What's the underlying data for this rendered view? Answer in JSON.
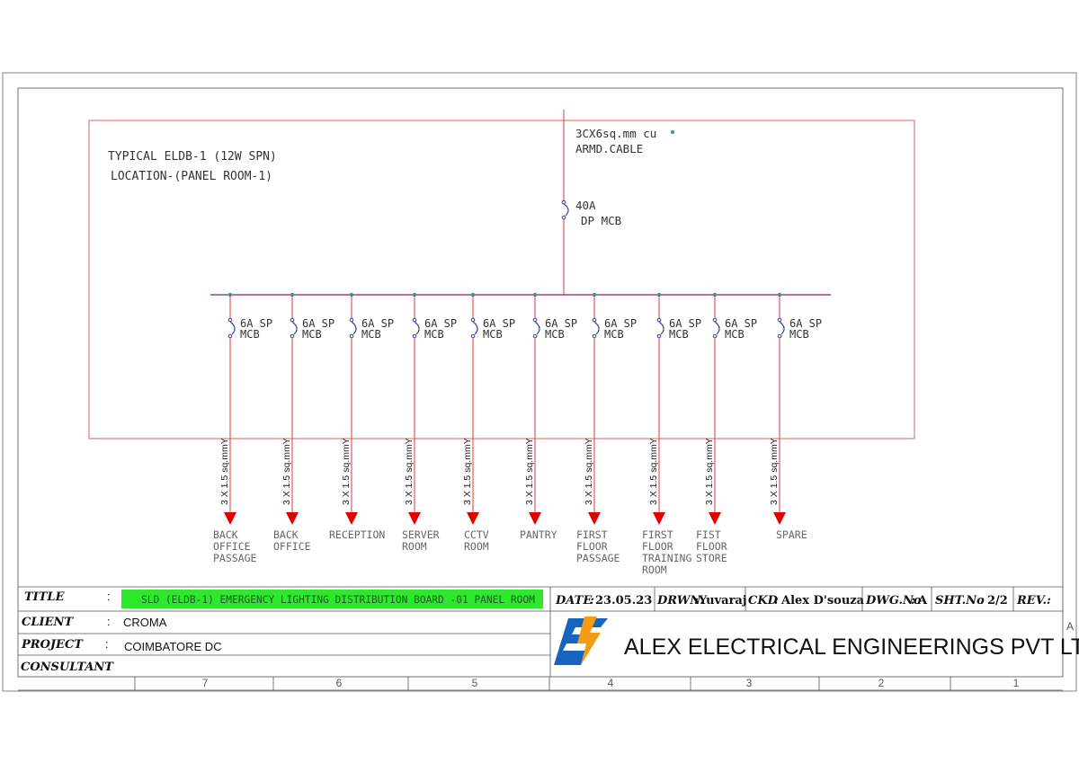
{
  "panel": {
    "title_line1": "TYPICAL ELDB-1 (12W SPN)",
    "title_line2": "LOCATION-(PANEL ROOM-1)",
    "incoming_cable_line1": "3CX6sq.mm cu",
    "incoming_cable_line2": "ARMD.CABLE",
    "main_breaker_line1": "40A",
    "main_breaker_line2": "DP MCB"
  },
  "feeders": [
    {
      "breaker": "6A SP",
      "breaker_type": "MCB",
      "cable": "3 X 1.5 sq.mmY",
      "load": [
        "BACK",
        "OFFICE",
        "PASSAGE"
      ]
    },
    {
      "breaker": "6A SP",
      "breaker_type": "MCB",
      "cable": "3 X 1.5 sq.mmY",
      "load": [
        "BACK",
        "OFFICE"
      ]
    },
    {
      "breaker": "6A SP",
      "breaker_type": "MCB",
      "cable": "3 X 1.5 sq.mmY",
      "load": [
        "RECEPTION"
      ]
    },
    {
      "breaker": "6A SP",
      "breaker_type": "MCB",
      "cable": "3 X 1.5 sq.mmY",
      "load": [
        "SERVER",
        "ROOM"
      ]
    },
    {
      "breaker": "6A SP",
      "breaker_type": "MCB",
      "cable": "3 X 1.5 sq.mmY",
      "load": [
        "CCTV",
        "ROOM"
      ]
    },
    {
      "breaker": "6A SP",
      "breaker_type": "MCB",
      "cable": "3 X 1.5 sq.mmY",
      "load": [
        "PANTRY"
      ]
    },
    {
      "breaker": "6A SP",
      "breaker_type": "MCB",
      "cable": "3 X 1.5 sq.mmY",
      "load": [
        "FIRST",
        "FLOOR",
        "PASSAGE"
      ]
    },
    {
      "breaker": "6A SP",
      "breaker_type": "MCB",
      "cable": "3 X 1.5 sq.mmY",
      "load": [
        "FIRST",
        "FLOOR",
        "TRAINING",
        "ROOM"
      ]
    },
    {
      "breaker": "6A SP",
      "breaker_type": "MCB",
      "cable": "3 X 1.5 sq.mmY",
      "load": [
        "FIST",
        "FLOOR",
        "STORE"
      ]
    },
    {
      "breaker": "6A SP",
      "breaker_type": "MCB",
      "cable": "3 X 1.5 sq.mmY",
      "load": [
        "SPARE"
      ]
    }
  ],
  "title_block": {
    "title_label": "TITLE",
    "title_value": "SLD (ELDB-1) EMERGENCY LIGHTING DISTRIBUTION BOARD -01 PANEL ROOM",
    "client_label": "CLIENT",
    "client_value": "CROMA",
    "project_label": "PROJECT",
    "project_value": "COIMBATORE DC",
    "consultant_label": "CONSULTANT",
    "colon": ":",
    "date_label": "DATE",
    "date_value": "23.05.23",
    "drawn_label": "DRWN.",
    "drawn_value": "Yuvaraj",
    "checked_label": "CKD",
    "checked_value": "Alex D'souza",
    "dwg_label": "DWG.No",
    "dwg_value": "A",
    "sht_label": "SHT.No",
    "sht_value": "2/2",
    "rev_label": "REV.",
    "company_name": "ALEX ELECTRICAL ENGINEERINGS PVT LTD",
    "logo_text": "AE"
  },
  "grid_columns": [
    "7",
    "6",
    "5",
    "4",
    "3",
    "2",
    "1"
  ],
  "grid_row_letter": "A",
  "colors": {
    "frame": "#808080",
    "panel_border": "#d9606a",
    "busbar": "#8a1a6a",
    "feeder_line": "#e03a3a",
    "arrow": "#e00000",
    "node": "#2a9d9d",
    "breaker": "#3a3aa0",
    "title_highlight": "#2ee82e",
    "logo_blue": "#1565c0",
    "logo_orange": "#f39c12"
  }
}
